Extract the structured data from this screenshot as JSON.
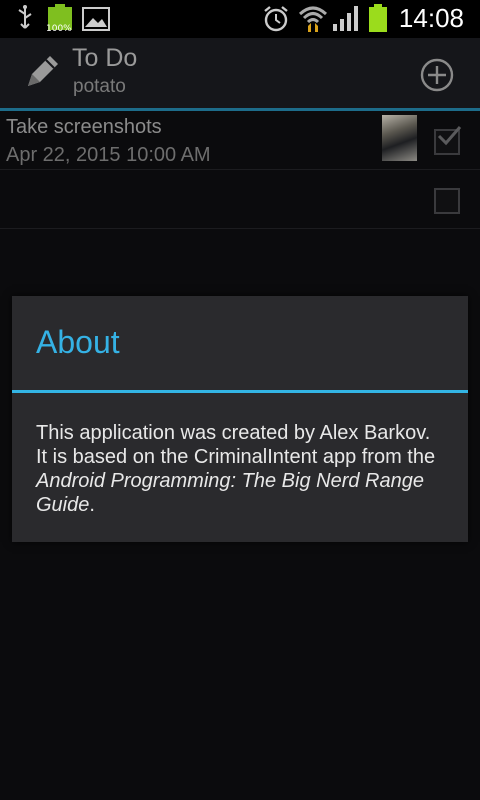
{
  "status_bar": {
    "time": "14:08",
    "battery_label": "100%",
    "icons": [
      "usb-icon",
      "battery-full-icon",
      "gallery-icon",
      "alarm-icon",
      "wifi-icon",
      "signal-icon",
      "battery-icon"
    ]
  },
  "action_bar": {
    "title": "To Do",
    "subtitle": "potato",
    "add_icon": "add-circle-icon"
  },
  "list": {
    "items": [
      {
        "title": "Take screenshots",
        "date": "Apr 22, 2015 10:00 AM",
        "checked": true,
        "has_photo": true
      },
      {
        "title": "",
        "date": "",
        "checked": false,
        "has_photo": false
      }
    ]
  },
  "dialog": {
    "title": "About",
    "body_prefix": "This application was created by Alex Barkov. It is based on the CriminalIntent app from the ",
    "body_italic": "Android Programming: The Big Nerd Range Guide",
    "body_suffix": "."
  },
  "colors": {
    "accent": "#33b5e5",
    "dialog_bg": "#2a2a2d"
  }
}
